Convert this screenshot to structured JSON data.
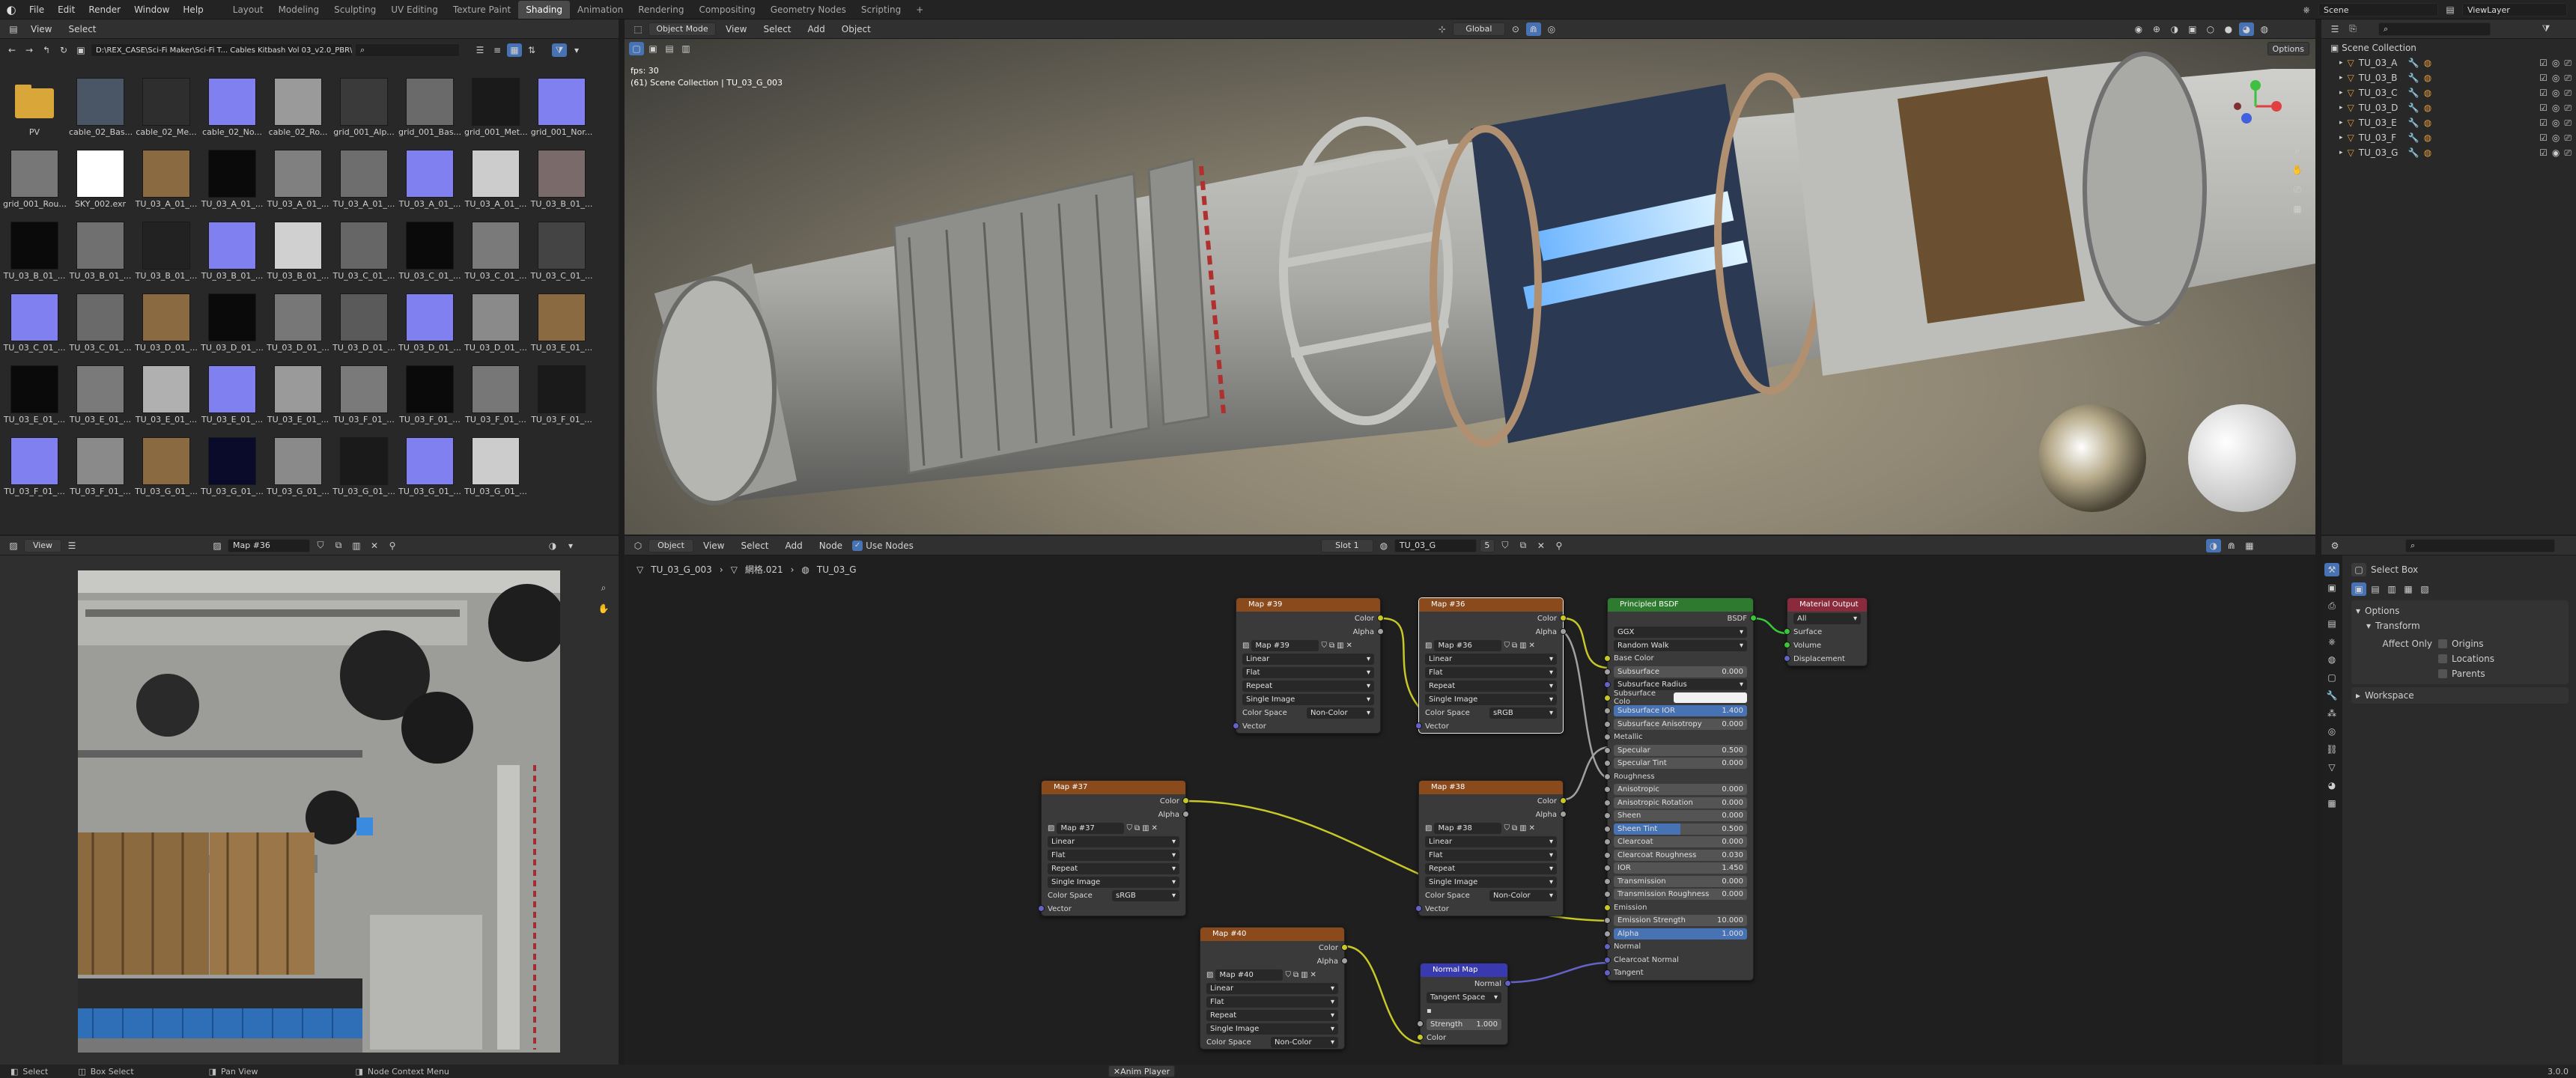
{
  "topbar": {
    "menus": [
      "File",
      "Edit",
      "Render",
      "Window",
      "Help"
    ],
    "workspaces": [
      "Layout",
      "Modeling",
      "Sculpting",
      "UV Editing",
      "Texture Paint",
      "Shading",
      "Animation",
      "Rendering",
      "Compositing",
      "Geometry Nodes",
      "Scripting"
    ],
    "active_workspace": "Shading",
    "plus": "+",
    "scene": "Scene",
    "view_layer": "ViewLayer"
  },
  "filebrowser": {
    "menus": [
      "View",
      "Select"
    ],
    "path": "D:\\REX_CASE\\Sci-Fi Maker\\Sci-Fi T... Cables Kitbash Vol 03_v2.0_PBR\\",
    "items": [
      {
        "label": "PV",
        "type": "folder"
      },
      {
        "label": "cable_02_Bas...",
        "color": "#4a5566"
      },
      {
        "label": "cable_02_Me...",
        "color": "#2e2e2e"
      },
      {
        "label": "cable_02_No...",
        "color": "#8080f0"
      },
      {
        "label": "cable_02_Ro...",
        "color": "#9a9a9a"
      },
      {
        "label": "grid_001_Alp...",
        "color": "#3a3a3a"
      },
      {
        "label": "grid_001_Bas...",
        "color": "#6a6a6a"
      },
      {
        "label": "grid_001_Met...",
        "color": "#1a1a1a"
      },
      {
        "label": "grid_001_Nor...",
        "color": "#8080f0"
      },
      {
        "label": "grid_001_Rou...",
        "color": "#777777"
      },
      {
        "label": "SKY_002.exr",
        "color": "#ffffff"
      },
      {
        "label": "TU_03_A_01_...",
        "color": "#8a6a40"
      },
      {
        "label": "TU_03_A_01_...",
        "color": "#0a0a0a"
      },
      {
        "label": "TU_03_A_01_...",
        "color": "#808080"
      },
      {
        "label": "TU_03_A_01_...",
        "color": "#6e6e6e"
      },
      {
        "label": "TU_03_A_01_...",
        "color": "#8080f0"
      },
      {
        "label": "TU_03_A_01_...",
        "color": "#cccccc"
      },
      {
        "label": "TU_03_B_01_...",
        "color": "#7a6a6a"
      },
      {
        "label": "TU_03_B_01_...",
        "color": "#0a0a0a"
      },
      {
        "label": "TU_03_B_01_...",
        "color": "#707070"
      },
      {
        "label": "TU_03_B_01_...",
        "color": "#222222"
      },
      {
        "label": "TU_03_B_01_...",
        "color": "#8080f0"
      },
      {
        "label": "TU_03_B_01_...",
        "color": "#d0d0d0"
      },
      {
        "label": "TU_03_C_01_...",
        "color": "#666666"
      },
      {
        "label": "TU_03_C_01_...",
        "color": "#0a0a0a"
      },
      {
        "label": "TU_03_C_01_...",
        "color": "#7a7a7a"
      },
      {
        "label": "TU_03_C_01_...",
        "color": "#444444"
      },
      {
        "label": "TU_03_C_01_...",
        "color": "#8080f0"
      },
      {
        "label": "TU_03_C_01_...",
        "color": "#6a6a6a"
      },
      {
        "label": "TU_03_D_01_...",
        "color": "#8a6a40"
      },
      {
        "label": "TU_03_D_01_...",
        "color": "#0a0a0a"
      },
      {
        "label": "TU_03_D_01_...",
        "color": "#777777"
      },
      {
        "label": "TU_03_D_01_...",
        "color": "#5a5a5a"
      },
      {
        "label": "TU_03_D_01_...",
        "color": "#8080f0"
      },
      {
        "label": "TU_03_D_01_...",
        "color": "#8a8a8a"
      },
      {
        "label": "TU_03_E_01_...",
        "color": "#8a6a40"
      },
      {
        "label": "TU_03_E_01_...",
        "color": "#0a0a0a"
      },
      {
        "label": "TU_03_E_01_...",
        "color": "#7a7a7a"
      },
      {
        "label": "TU_03_E_01_...",
        "color": "#b0b0b0"
      },
      {
        "label": "TU_03_E_01_...",
        "color": "#8080f0"
      },
      {
        "label": "TU_03_E_01_...",
        "color": "#9a9a9a"
      },
      {
        "label": "TU_03_F_01_...",
        "color": "#7a7a7a"
      },
      {
        "label": "TU_03_F_01_...",
        "color": "#0a0a0a"
      },
      {
        "label": "TU_03_F_01_...",
        "color": "#777777"
      },
      {
        "label": "TU_03_F_01_...",
        "color": "#1a1a1a"
      },
      {
        "label": "TU_03_F_01_...",
        "color": "#8080f0"
      },
      {
        "label": "TU_03_F_01_...",
        "color": "#8a8a8a"
      },
      {
        "label": "TU_03_G_01_...",
        "color": "#8a6a40"
      },
      {
        "label": "TU_03_G_01_...",
        "color": "#0a0a2a"
      },
      {
        "label": "TU_03_G_01_...",
        "color": "#8a8a8a"
      },
      {
        "label": "TU_03_G_01_...",
        "color": "#1a1a1a"
      },
      {
        "label": "TU_03_G_01_...",
        "color": "#8080f0"
      },
      {
        "label": "TU_03_G_01_...",
        "color": "#cccccc"
      }
    ]
  },
  "viewport": {
    "mode": "Object Mode",
    "menus": [
      "View",
      "Select",
      "Add",
      "Object"
    ],
    "transform": "Global",
    "options": "Options",
    "fps": "fps: 30",
    "collection_info": "(61) Scene Collection | TU_03_G_003"
  },
  "outliner": {
    "root": "Scene Collection",
    "items": [
      "TU_03_A",
      "TU_03_B",
      "TU_03_C",
      "TU_03_D",
      "TU_03_E",
      "TU_03_F",
      "TU_03_G"
    ]
  },
  "image_editor": {
    "menus": [
      "View"
    ],
    "image": "Map #36"
  },
  "node_editor": {
    "object_mode": "Object",
    "menus": [
      "View",
      "Select",
      "Add",
      "Node"
    ],
    "use_nodes": "Use Nodes",
    "slot": "Slot 1",
    "material": "TU_03_G",
    "users": "5",
    "breadcrumb": [
      "TU_03_G_003",
      "網格.021",
      "TU_03_G"
    ]
  },
  "nodes": {
    "map39": {
      "title": "Map #39",
      "image": "Map #39",
      "interp": "Linear",
      "proj": "Flat",
      "ext": "Repeat",
      "src": "Single Image",
      "cs_label": "Color Space",
      "cs": "Non-Color",
      "out1": "Color",
      "out2": "Alpha",
      "in": "Vector"
    },
    "map36": {
      "title": "Map #36",
      "image": "Map #36",
      "interp": "Linear",
      "proj": "Flat",
      "ext": "Repeat",
      "src": "Single Image",
      "cs_label": "Color Space",
      "cs": "sRGB",
      "out1": "Color",
      "out2": "Alpha",
      "in": "Vector"
    },
    "map37": {
      "title": "Map #37",
      "image": "Map #37",
      "interp": "Linear",
      "proj": "Flat",
      "ext": "Repeat",
      "src": "Single Image",
      "cs_label": "Color Space",
      "cs": "sRGB",
      "out1": "Color",
      "out2": "Alpha",
      "in": "Vector"
    },
    "map38": {
      "title": "Map #38",
      "image": "Map #38",
      "interp": "Linear",
      "proj": "Flat",
      "ext": "Repeat",
      "src": "Single Image",
      "cs_label": "Color Space",
      "cs": "Non-Color",
      "out1": "Color",
      "out2": "Alpha",
      "in": "Vector"
    },
    "map40": {
      "title": "Map #40",
      "image": "Map #40",
      "interp": "Linear",
      "proj": "Flat",
      "ext": "Repeat",
      "src": "Single Image",
      "cs_label": "Color Space",
      "cs": "Non-Color",
      "out1": "Color",
      "out2": "Alpha"
    },
    "normal": {
      "title": "Normal Map",
      "out": "Normal",
      "space": "Tangent Space",
      "strength_label": "Strength",
      "strength": "1.000",
      "in": "Color"
    },
    "bsdf": {
      "title": "Principled BSDF",
      "out": "BSDF",
      "dist": "GGX",
      "sss": "Random Walk",
      "rows": [
        {
          "label": "Base Color",
          "kind": "socket"
        },
        {
          "label": "Subsurface",
          "value": "0.000"
        },
        {
          "label": "Subsurface Radius",
          "kind": "dropdown"
        },
        {
          "label": "Subsurface Colo",
          "kind": "white"
        },
        {
          "label": "Subsurface IOR",
          "value": "1.400",
          "blue": true
        },
        {
          "label": "Subsurface Anisotropy",
          "value": "0.000"
        },
        {
          "label": "Metallic",
          "kind": "socket"
        },
        {
          "label": "Specular",
          "value": "0.500"
        },
        {
          "label": "Specular Tint",
          "value": "0.000"
        },
        {
          "label": "Roughness",
          "kind": "socket"
        },
        {
          "label": "Anisotropic",
          "value": "0.000"
        },
        {
          "label": "Anisotropic Rotation",
          "value": "0.000"
        },
        {
          "label": "Sheen",
          "value": "0.000"
        },
        {
          "label": "Sheen Tint",
          "value": "0.500",
          "half": true
        },
        {
          "label": "Clearcoat",
          "value": "0.000"
        },
        {
          "label": "Clearcoat Roughness",
          "value": "0.030"
        },
        {
          "label": "IOR",
          "value": "1.450"
        },
        {
          "label": "Transmission",
          "value": "0.000"
        },
        {
          "label": "Transmission Roughness",
          "value": "0.000"
        },
        {
          "label": "Emission",
          "kind": "socket"
        },
        {
          "label": "Emission Strength",
          "value": "10.000"
        },
        {
          "label": "Alpha",
          "value": "1.000",
          "blue": true
        },
        {
          "label": "Normal",
          "kind": "socket"
        },
        {
          "label": "Clearcoat Normal",
          "kind": "socket"
        },
        {
          "label": "Tangent",
          "kind": "socket"
        }
      ]
    },
    "output": {
      "title": "Material Output",
      "target": "All",
      "inputs": [
        "Surface",
        "Volume",
        "Displacement"
      ]
    }
  },
  "properties": {
    "tool": "Select Box",
    "options": "Options",
    "transform": "Transform",
    "affect_only": "Affect Only",
    "checks": [
      "Origins",
      "Locations",
      "Parents"
    ],
    "workspace": "Workspace"
  },
  "statusbar": {
    "items": [
      "Select",
      "Box Select",
      "Pan View",
      "Node Context Menu"
    ],
    "center": "Anim Player",
    "version": "3.0.0"
  }
}
